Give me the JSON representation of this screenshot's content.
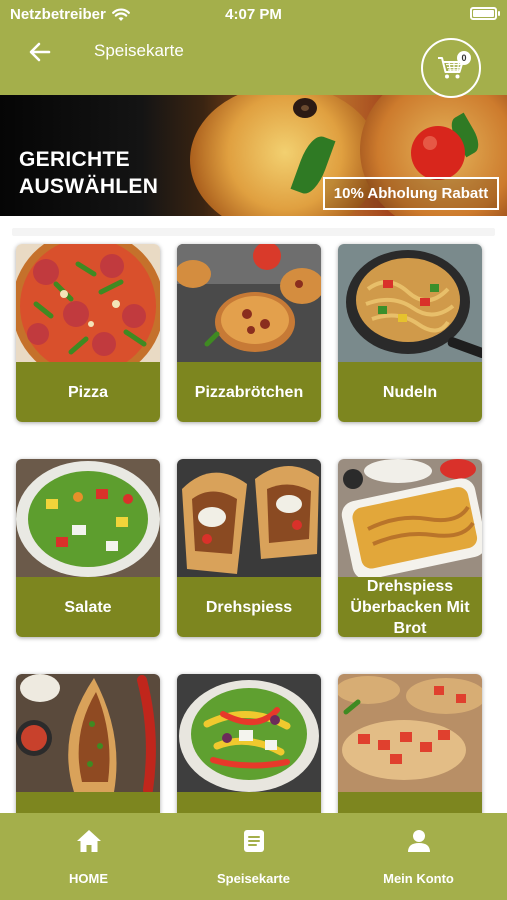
{
  "status_bar": {
    "carrier": "Netzbetreiber",
    "time": "4:07 PM"
  },
  "header": {
    "title": "Speisekarte",
    "cart_count": "0"
  },
  "banner": {
    "title_line1": "GERICHTE",
    "title_line2": "AUSWÄHLEN",
    "badge": "10% Abholung Rabatt"
  },
  "categories": [
    {
      "label": "Pizza",
      "icon": "pizza-image"
    },
    {
      "label": "Pizzabrötchen",
      "icon": "pizza-rolls-image"
    },
    {
      "label": "Nudeln",
      "icon": "noodles-image"
    },
    {
      "label": "Salate",
      "icon": "salad-image"
    },
    {
      "label": "Drehspiess",
      "icon": "doner-image"
    },
    {
      "label": "Drehspiess Überbacken Mit Brot",
      "icon": "baked-doner-image"
    },
    {
      "label": "",
      "icon": "pide-image"
    },
    {
      "label": "",
      "icon": "salad-bowl-image"
    },
    {
      "label": "",
      "icon": "bruschetta-image"
    }
  ],
  "tabbar": {
    "home": "HOME",
    "menu": "Speisekarte",
    "account": "Mein Konto"
  },
  "colors": {
    "header_green": "#a4af4b",
    "card_label_green": "#7d861f",
    "text_white": "#ffffff"
  }
}
